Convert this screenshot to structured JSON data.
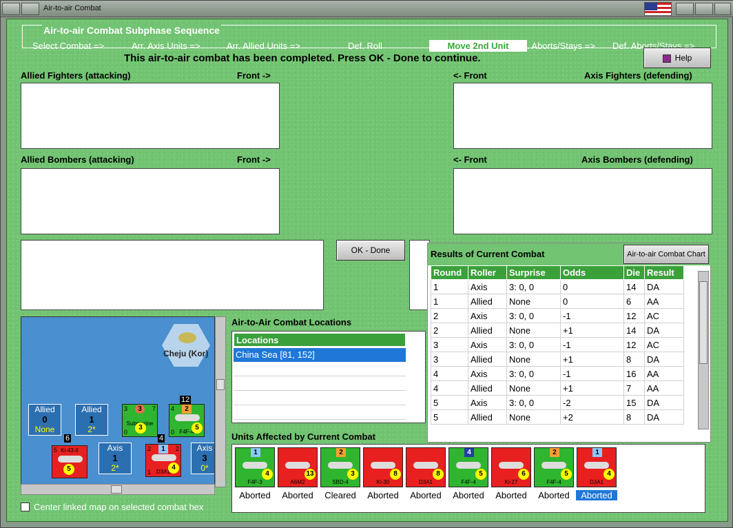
{
  "window": {
    "title": "Air-to-air Combat"
  },
  "phase": {
    "title": "Air-to-air Combat Subphase Sequence",
    "steps": [
      "Select Combat =>",
      "Arr. Axis Units =>",
      "Arr. Allied Units =>",
      "Def. Roll",
      "Move 2nd Unit",
      "Att. Aborts/Stays =>",
      "Def. Aborts/Stays =>"
    ],
    "active_step": "Move 2nd Unit"
  },
  "status_message": "This air-to-air combat has been completed.  Press OK - Done to continue.",
  "help_label": "Help",
  "panels": {
    "allied_fighters": "Allied Fighters (attacking)",
    "axis_fighters": "Axis Fighters (defending)",
    "allied_bombers": "Allied Bombers (attacking)",
    "axis_bombers": "Axis Bombers (defending)",
    "front_right": "Front ->",
    "front_left": "<- Front"
  },
  "ok_done_label": "OK - Done",
  "results": {
    "title": "Results of Current Combat",
    "chart_button": "Air-to-air Combat Chart",
    "columns": [
      "Round",
      "Roller",
      "Surprise",
      "Odds",
      "Die",
      "Result"
    ],
    "rows": [
      [
        "1",
        "Axis",
        "3: 0, 0",
        "0",
        "14",
        "DA"
      ],
      [
        "1",
        "Allied",
        "None",
        "0",
        "6",
        "AA"
      ],
      [
        "2",
        "Axis",
        "3: 0, 0",
        "-1",
        "12",
        "AC"
      ],
      [
        "2",
        "Allied",
        "None",
        "+1",
        "14",
        "DA"
      ],
      [
        "3",
        "Axis",
        "3: 0, 0",
        "-1",
        "12",
        "AC"
      ],
      [
        "3",
        "Allied",
        "None",
        "+1",
        "8",
        "DA"
      ],
      [
        "4",
        "Axis",
        "3: 0, 0",
        "-1",
        "16",
        "AA"
      ],
      [
        "4",
        "Allied",
        "None",
        "+1",
        "7",
        "AA"
      ],
      [
        "5",
        "Axis",
        "3: 0, 0",
        "-2",
        "15",
        "DA"
      ],
      [
        "5",
        "Allied",
        "None",
        "+2",
        "8",
        "DA"
      ]
    ]
  },
  "locations": {
    "title": "Air-to-Air Combat Locations",
    "header": "Locations",
    "items": [
      "China Sea [81, 152]"
    ]
  },
  "map": {
    "hex_name": "Cheju (Kor)",
    "allied_box_1": {
      "label": "Allied",
      "count": "0",
      "sub": "None"
    },
    "allied_box_2": {
      "label": "Allied",
      "count": "1",
      "sub": "2*"
    },
    "axis_box_1": {
      "label": "Axis",
      "count": "1",
      "sub": "2*"
    },
    "axis_box_2": {
      "label": "Axis",
      "count": "3",
      "sub": "0*"
    },
    "stack_count_1": "12",
    "stack_count_2": "6",
    "stack_count_3": "4",
    "counters": [
      {
        "name": "Submarine",
        "tl": "3",
        "code": "3",
        "die": "3",
        "bl": "0",
        "tr": "7"
      },
      {
        "name": "F4F-4",
        "tl": "4",
        "code": "2",
        "die": "5",
        "bl": "0",
        "tr": ""
      },
      {
        "name": "Ki-43-II",
        "tl": "5",
        "code": "",
        "die": "5",
        "bl": "",
        "tr": ""
      },
      {
        "name": "D3A1",
        "tl": "2",
        "code": "1",
        "die": "4",
        "bl": "1",
        "tr": "2"
      }
    ]
  },
  "center_map_label": "Center linked map on selected combat hex",
  "affected": {
    "title": "Units Affected by Current Combat",
    "units": [
      {
        "name": "F4F-3",
        "code": "1",
        "die": "4",
        "color": "#2fb52f",
        "code_color": "#8ec8ff",
        "status": "Aborted"
      },
      {
        "name": "A6M2",
        "code": "",
        "die": "13",
        "color": "#e82020",
        "code_color": "",
        "status": "Aborted"
      },
      {
        "name": "SBD-4",
        "code": "2",
        "die": "3",
        "color": "#2fb52f",
        "code_color": "#f7a032",
        "status": "Cleared"
      },
      {
        "name": "Ki-30",
        "code": "",
        "die": "8",
        "color": "#e82020",
        "code_color": "",
        "status": "Aborted"
      },
      {
        "name": "D3A1",
        "code": "",
        "die": "8",
        "color": "#e82020",
        "code_color": "",
        "status": "Aborted"
      },
      {
        "name": "F4F-4",
        "code": "4",
        "die": "5",
        "color": "#2fb52f",
        "code_color": "#1f3fa8",
        "status": "Aborted"
      },
      {
        "name": "Ki-27",
        "code": "",
        "die": "6",
        "color": "#e82020",
        "code_color": "",
        "status": "Aborted"
      },
      {
        "name": "F4F-4",
        "code": "2",
        "die": "5",
        "color": "#2fb52f",
        "code_color": "#f7a032",
        "status": "Aborted"
      },
      {
        "name": "D3A1",
        "code": "1",
        "die": "4",
        "color": "#e82020",
        "code_color": "#8ec8ff",
        "status": "Aborted"
      }
    ]
  }
}
